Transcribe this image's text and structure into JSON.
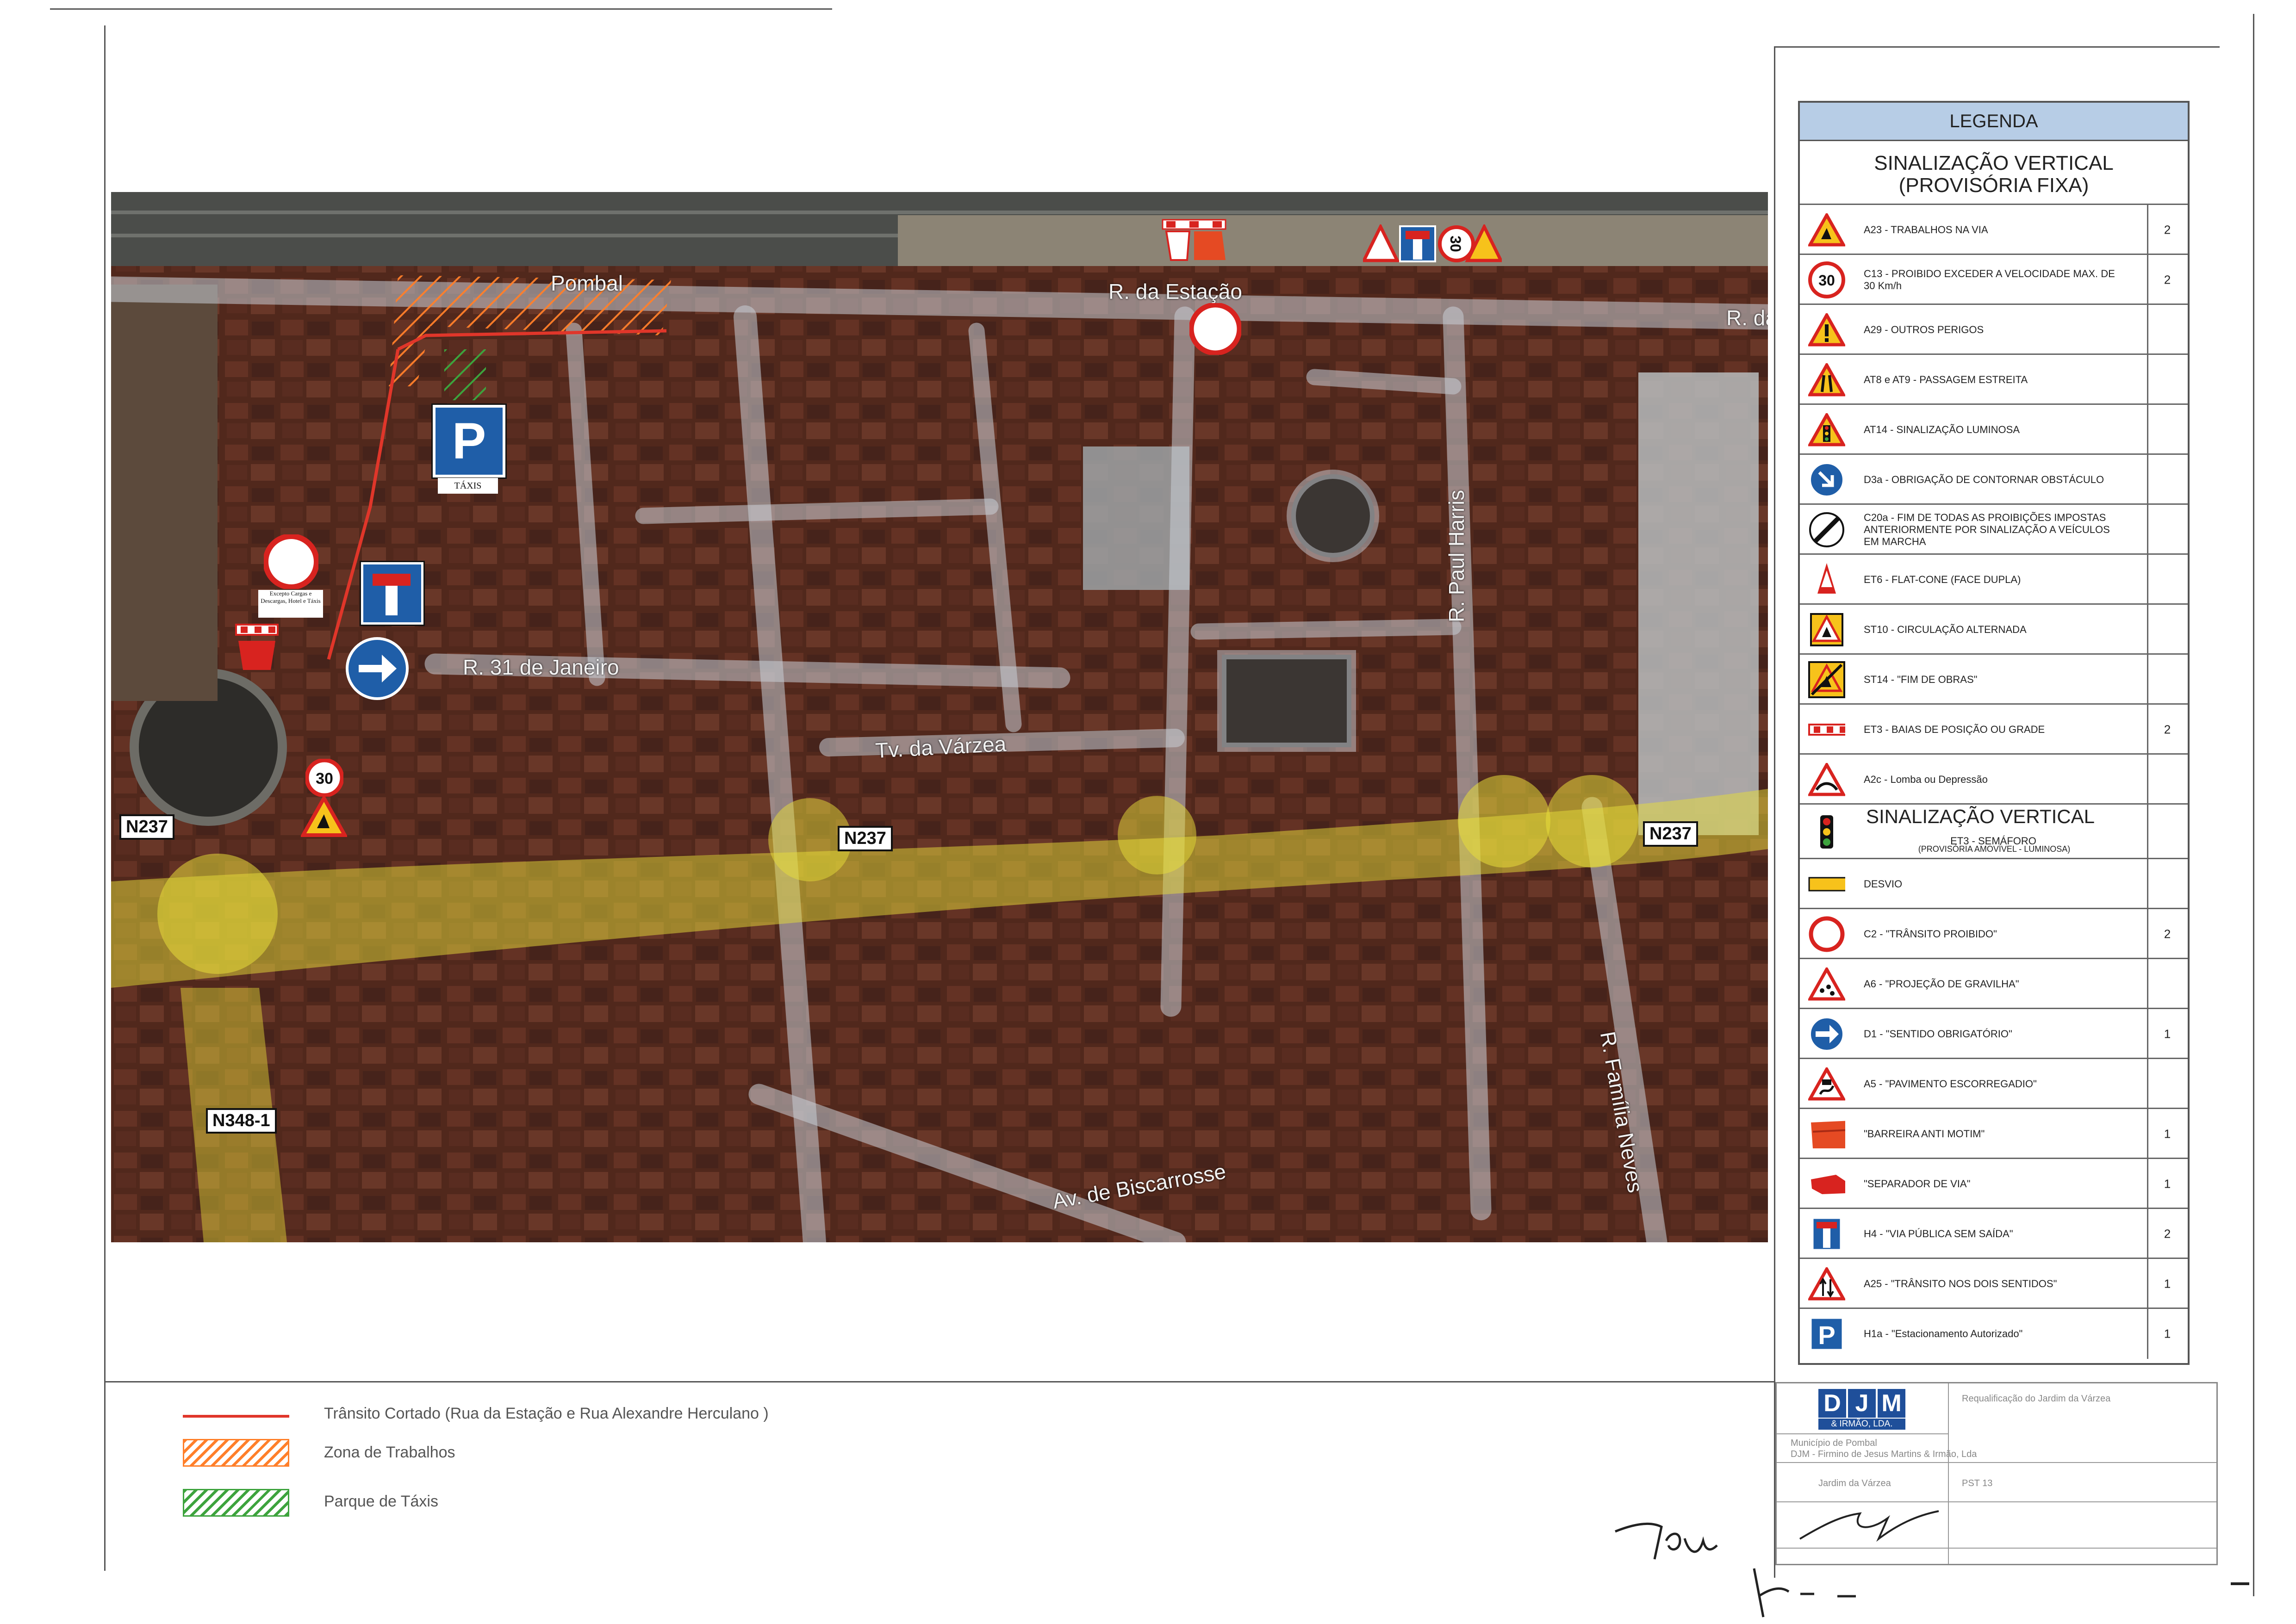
{
  "map": {
    "station_label": "Pombal",
    "streets": [
      {
        "key": "estacao",
        "label": "R. da Estação"
      },
      {
        "key": "estacao_cut",
        "label": "R. da"
      },
      {
        "key": "janeiro",
        "label": "R. 31 de Janeiro"
      },
      {
        "key": "varzea",
        "label": "Tv. da Várzea"
      },
      {
        "key": "paul_harris",
        "label": "R. Paul Harris"
      },
      {
        "key": "familia_neves",
        "label": "R. Família Neves"
      },
      {
        "key": "biscarrosse",
        "label": "Av. de Biscarrosse"
      }
    ],
    "road_tags": [
      {
        "key": "n237_w",
        "label": "N237"
      },
      {
        "key": "n237_c",
        "label": "N237"
      },
      {
        "key": "n237_e",
        "label": "N237"
      },
      {
        "key": "n348",
        "label": "N348-1"
      }
    ],
    "taxi_label": "TÁXIS",
    "exception_note": "Excepto Cargas e Descargas, Hotel e Táxis",
    "speed_limit": "30",
    "colors": {
      "closure_line": "#e0362a",
      "work_zone": "#ff7f2a",
      "taxi_zone": "#3da33d",
      "highlight": "#e8dd3a",
      "sign_red": "#d8231f",
      "sign_blue": "#1f5ea8"
    }
  },
  "legend": {
    "header": "LEGENDA",
    "section_fixed_title": "SINALIZAÇÃO VERTICAL",
    "section_fixed_subtitle": "(PROVISÓRIA FIXA)",
    "section_mobile_title": "SINALIZAÇÃO VERTICAL",
    "section_mobile_subtitle": "(PROVISÓRIA AMOVÍVEL - LUMINOSA)",
    "items": [
      {
        "icon": "warning-roadwork-icon",
        "label": "A23 - TRABALHOS NA VIA",
        "qty": "2"
      },
      {
        "icon": "speed-limit-30-icon",
        "label": "C13 - PROIBIDO EXCEDER A VELOCIDADE MAX. DE 30 Km/h",
        "qty": "2"
      },
      {
        "icon": "warning-other-dangers-icon",
        "label": "A29 - OUTROS PERIGOS",
        "qty": ""
      },
      {
        "icon": "warning-narrow-road-icon",
        "label": "AT8 e AT9 - PASSAGEM ESTREITA",
        "qty": ""
      },
      {
        "icon": "warning-signal-light-icon",
        "label": "AT14 - SINALIZAÇÃO LUMINOSA",
        "qty": ""
      },
      {
        "icon": "keep-right-icon",
        "label": "D3a - OBRIGAÇÃO DE CONTORNAR OBSTÁCULO",
        "qty": ""
      },
      {
        "icon": "end-restrictions-icon",
        "label": "C20a - FIM DE TODAS AS PROIBIÇÕES IMPOSTAS ANTERIORMENTE POR SINALIZAÇÃO A VEÍCULOS EM MARCHA",
        "qty": ""
      },
      {
        "icon": "flat-cone-icon",
        "label": "ET6 - FLAT-CONE (FACE DUPLA)",
        "qty": ""
      },
      {
        "icon": "alternating-traffic-icon",
        "label": "ST10 - CIRCULAÇÃO ALTERNADA",
        "qty": ""
      },
      {
        "icon": "end-of-works-icon",
        "label": "ST14 - \"FIM DE OBRAS\"",
        "qty": ""
      },
      {
        "icon": "barrier-bar-icon",
        "label": "ET3 - BAIAS DE POSIÇÃO OU GRADE",
        "qty": "2"
      },
      {
        "icon": "warning-bump-icon",
        "label": "A2c - Lomba ou Depressão",
        "qty": ""
      },
      {
        "icon": "traffic-light-icon",
        "label": "ET3 - SEMÁFORO",
        "qty": ""
      },
      {
        "icon": "detour-arrow-icon",
        "label": "DESVIO",
        "qty": ""
      },
      {
        "icon": "no-entry-circle-icon",
        "label": "C2 - \"TRÂNSITO PROIBIDO\"",
        "qty": "2"
      },
      {
        "icon": "warning-gravel-icon",
        "label": "A6 - \"PROJEÇÃO DE GRAVILHA\"",
        "qty": ""
      },
      {
        "icon": "mandatory-direction-icon",
        "label": "D1 - \"SENTIDO OBRIGATÓRIO\"",
        "qty": "1"
      },
      {
        "icon": "warning-slippery-icon",
        "label": "A5 - \"PAVIMENTO ESCORREGADIO\"",
        "qty": ""
      },
      {
        "icon": "anti-riot-barrier-icon",
        "label": "\"BARREIRA ANTI MOTIM\"",
        "qty": "1"
      },
      {
        "icon": "lane-separator-icon",
        "label": "\"SEPARADOR DE VIA\"",
        "qty": "1"
      },
      {
        "icon": "dead-end-icon",
        "label": "H4 - \"VIA PÚBLICA SEM SAÍDA\"",
        "qty": "2"
      },
      {
        "icon": "two-way-traffic-icon",
        "label": "A25 - \"TRÂNSITO NOS DOIS SENTIDOS\"",
        "qty": "1"
      },
      {
        "icon": "parking-icon",
        "label": "H1a - \"Estacionamento Autorizado\"",
        "qty": "1"
      }
    ]
  },
  "key": {
    "closure": "Trânsito Cortado  (Rua da Estação e Rua Alexandre Herculano )",
    "works": "Zona de Trabalhos",
    "taxi": "Parque de Táxis"
  },
  "title_block": {
    "company_initials": [
      "D",
      "J",
      "M"
    ],
    "company_sub": "& IRMÃO, LDA.",
    "project": "Requalificação do Jardim da Várzea",
    "owner": "Município de Pombal",
    "contractor": "DJM - Firmino de Jesus Martins & Irmão, Lda",
    "location": "Jardim da Várzea",
    "drawing": "PST 13"
  }
}
